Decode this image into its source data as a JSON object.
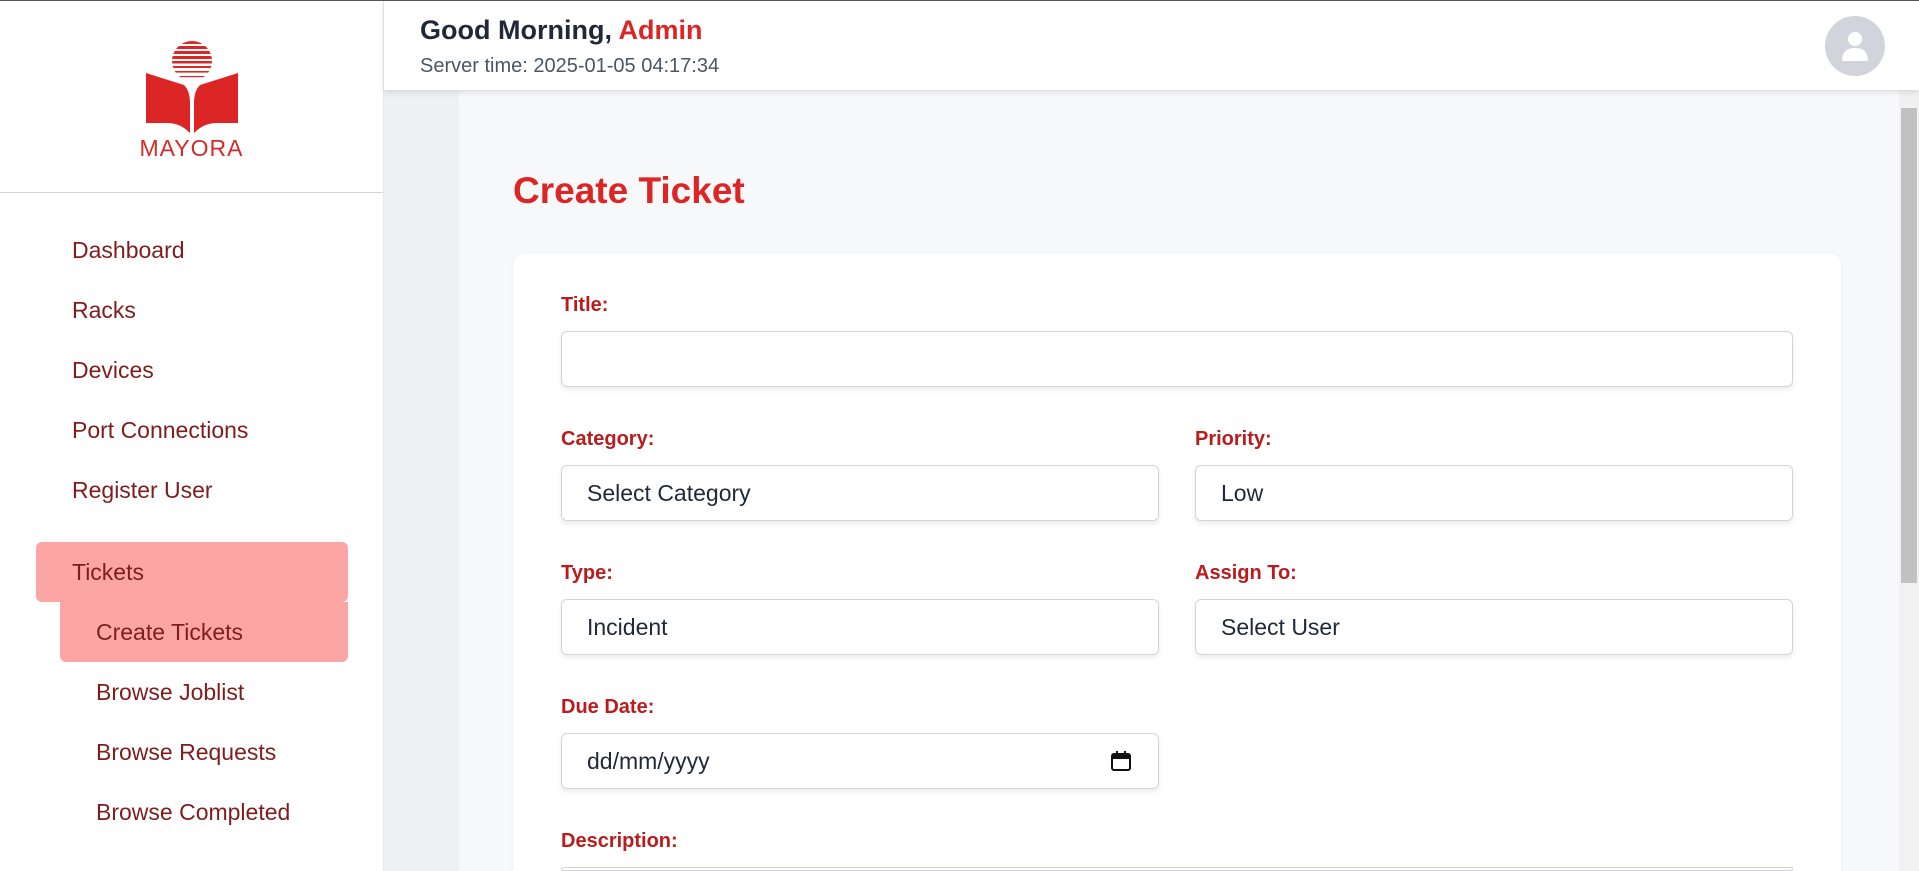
{
  "logo": {
    "text": "MAYORA"
  },
  "header": {
    "greeting_prefix": "Good Morning, ",
    "user_name": "Admin",
    "server_time": "Server time: 2025-01-05 04:17:34"
  },
  "sidebar": {
    "items": [
      {
        "label": "Dashboard"
      },
      {
        "label": "Racks"
      },
      {
        "label": "Devices"
      },
      {
        "label": "Port Connections"
      },
      {
        "label": "Register User"
      },
      {
        "label": "Tickets"
      }
    ],
    "sub_items": [
      {
        "label": "Create Tickets"
      },
      {
        "label": "Browse Joblist"
      },
      {
        "label": "Browse Requests"
      },
      {
        "label": "Browse Completed"
      }
    ]
  },
  "page": {
    "title": "Create Ticket"
  },
  "form": {
    "title_label": "Title:",
    "title_value": "",
    "category_label": "Category:",
    "category_value": "Select Category",
    "priority_label": "Priority:",
    "priority_value": "Low",
    "type_label": "Type:",
    "type_value": "Incident",
    "assign_label": "Assign To:",
    "assign_value": "Select User",
    "due_label": "Due Date:",
    "due_value": "dd/mm/yyyy",
    "description_label": "Description:"
  },
  "colors": {
    "accent": "#dc2626",
    "nav_text": "#7f1d1d",
    "nav_active_bg": "#fca5a5"
  },
  "icons": {
    "avatar": "user-icon",
    "date": "calendar-icon"
  }
}
